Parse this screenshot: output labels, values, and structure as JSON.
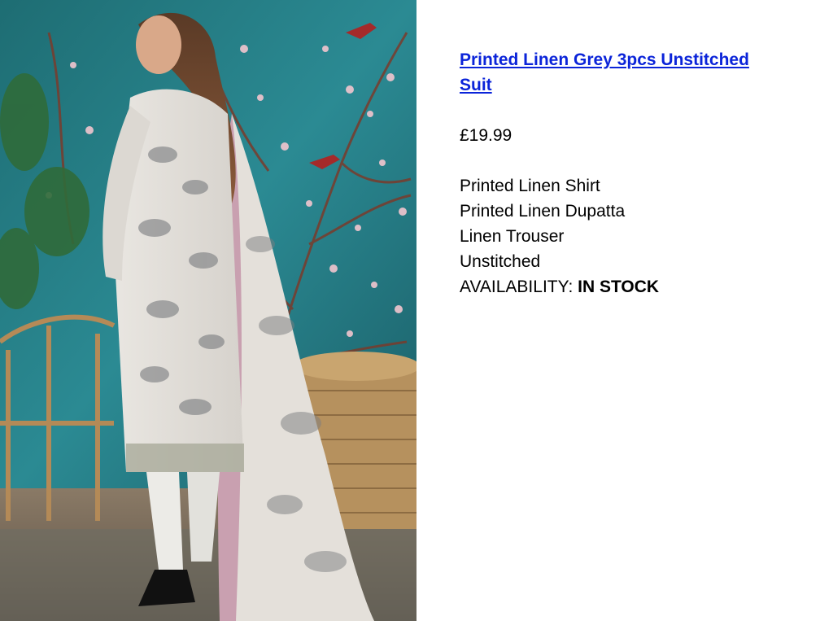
{
  "product": {
    "title": "Printed Linen Grey 3pcs Unstitched Suit",
    "price": "£19.99",
    "features": [
      "Printed Linen Shirt",
      "Printed Linen Dupatta",
      "Linen Trouser",
      "Unstitched"
    ],
    "availability_label": "AVAILABILITY:",
    "availability_value": "IN STOCK"
  },
  "photo": {
    "alt": "product-photo"
  },
  "colors": {
    "link": "#0b24d9",
    "text": "#000000",
    "photo_wall": "#1f6f7a"
  }
}
